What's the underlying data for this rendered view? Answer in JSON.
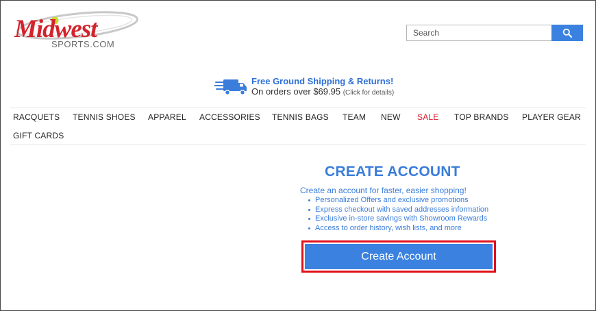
{
  "header": {
    "logo": {
      "brand": "Midwest",
      "sub": "SPORTS.COM"
    },
    "search": {
      "placeholder": "Search",
      "value": "",
      "button_icon": "search-icon"
    }
  },
  "promo": {
    "title": "Free Ground Shipping & Returns!",
    "subtitle": "On orders over $69.95",
    "note": "(Click for details)",
    "icon": "truck-icon"
  },
  "nav": {
    "items": [
      {
        "label": "RACQUETS"
      },
      {
        "label": "TENNIS SHOES"
      },
      {
        "label": "APPAREL"
      },
      {
        "label": "ACCESSORIES"
      },
      {
        "label": "TENNIS BAGS"
      },
      {
        "label": "TEAM"
      },
      {
        "label": "NEW"
      },
      {
        "label": "SALE",
        "color": "#e0182b"
      },
      {
        "label": "TOP BRANDS"
      },
      {
        "label": "PLAYER GEAR"
      },
      {
        "label": "GIFT CARDS"
      }
    ]
  },
  "create_account": {
    "title": "CREATE ACCOUNT",
    "intro": "Create an account for faster, easier shopping!",
    "benefits": [
      "Personalized Offers and exclusive promotions",
      "Express checkout with saved addresses information",
      "Exclusive in-store savings with Showroom Rewards",
      "Access to order history, wish lists, and more"
    ],
    "button_label": "Create Account"
  },
  "colors": {
    "brand_red": "#d3232c",
    "accent_blue": "#3b82e0",
    "highlight_red": "#e0101a",
    "sale_red": "#e0182b"
  }
}
